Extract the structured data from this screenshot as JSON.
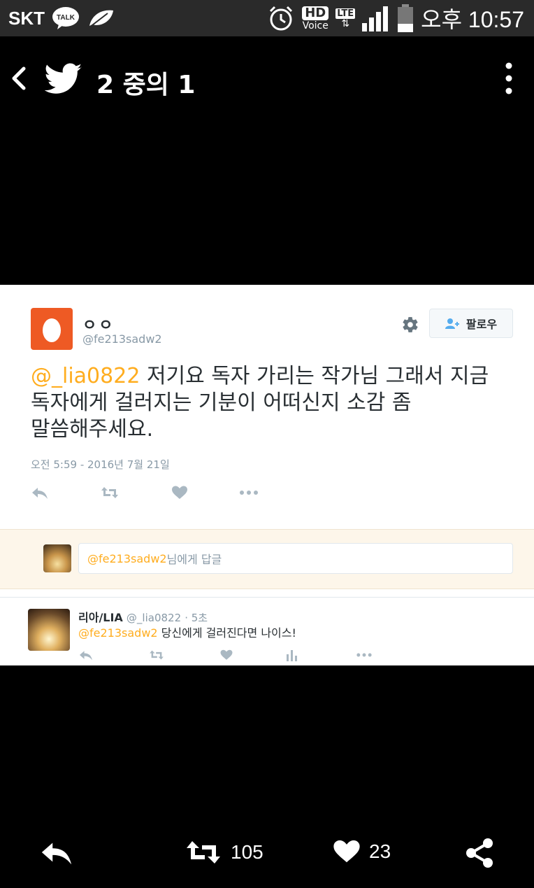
{
  "status_bar": {
    "carrier": "SKT",
    "talk_badge": "TALK",
    "hd_label": "HD",
    "voice_label": "Voice",
    "lte_label": "LTE",
    "time": "오후 10:57"
  },
  "app_bar": {
    "counter": "2 중의 1"
  },
  "tweet": {
    "author_name": "ㅇㅇ",
    "author_handle": "@fe213sadw2",
    "follow_label": "팔로우",
    "mention": "@_lia0822",
    "text": " 저기요 독자 가리는 작가님 그래서 지금 독자에게 걸러지는 기분이 어떠신지 소감 좀 말씀해주세요.",
    "timestamp": "오전 5:59 - 2016년 7월 21일"
  },
  "reply_box": {
    "mention": "@fe213sadw2",
    "placeholder_suffix": " 님에게 답글"
  },
  "reply_tweet": {
    "author_name": "리아/LIA",
    "author_handle": "@_lia0822",
    "time": "· 5초",
    "mention": "@fe213sadw2",
    "text": " 당신에게 걸러진다면 나이스!"
  },
  "bottom_bar": {
    "retweet_count": "105",
    "like_count": "23"
  },
  "colors": {
    "mention": "#ffad1f",
    "egg_avatar": "#ee5a24",
    "reply_area_bg": "#fdf6ea"
  }
}
